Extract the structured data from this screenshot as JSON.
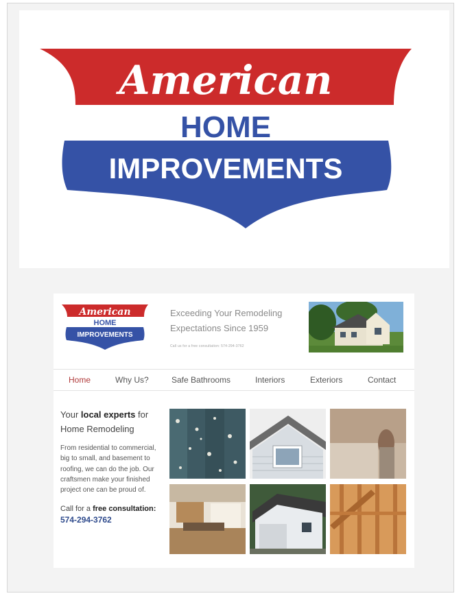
{
  "logo": {
    "script_word": "American",
    "home_word": "HOME",
    "improvements_word": "IMPROVEMENTS",
    "colors": {
      "red": "#cc2b2b",
      "blue": "#3552a6"
    }
  },
  "website": {
    "tagline_line1": "Exceeding Your Remodeling",
    "tagline_line2": "Expectations Since 1959",
    "tiny_call": "Call us for a free consultation: 574-294-3762",
    "nav": [
      "Home",
      "Why Us?",
      "Safe Bathrooms",
      "Interiors",
      "Exteriors",
      "Contact"
    ],
    "intro": {
      "line_a": "Your ",
      "line_b": "local experts",
      "line_c": " for",
      "line_d": "Home Remodeling",
      "body": "From residential to commercial, big to small, and basement to roofing, we can do the job. Our craftsmen make your finished project one can be proud of.",
      "call_prefix": "Call for a ",
      "call_bold": "free consultation:",
      "phone": "574-294-3762"
    },
    "tiles": [
      "mold-wall",
      "house-gable-window",
      "wall-repair",
      "kitchen-interior",
      "detached-garage",
      "wood-framing"
    ]
  }
}
